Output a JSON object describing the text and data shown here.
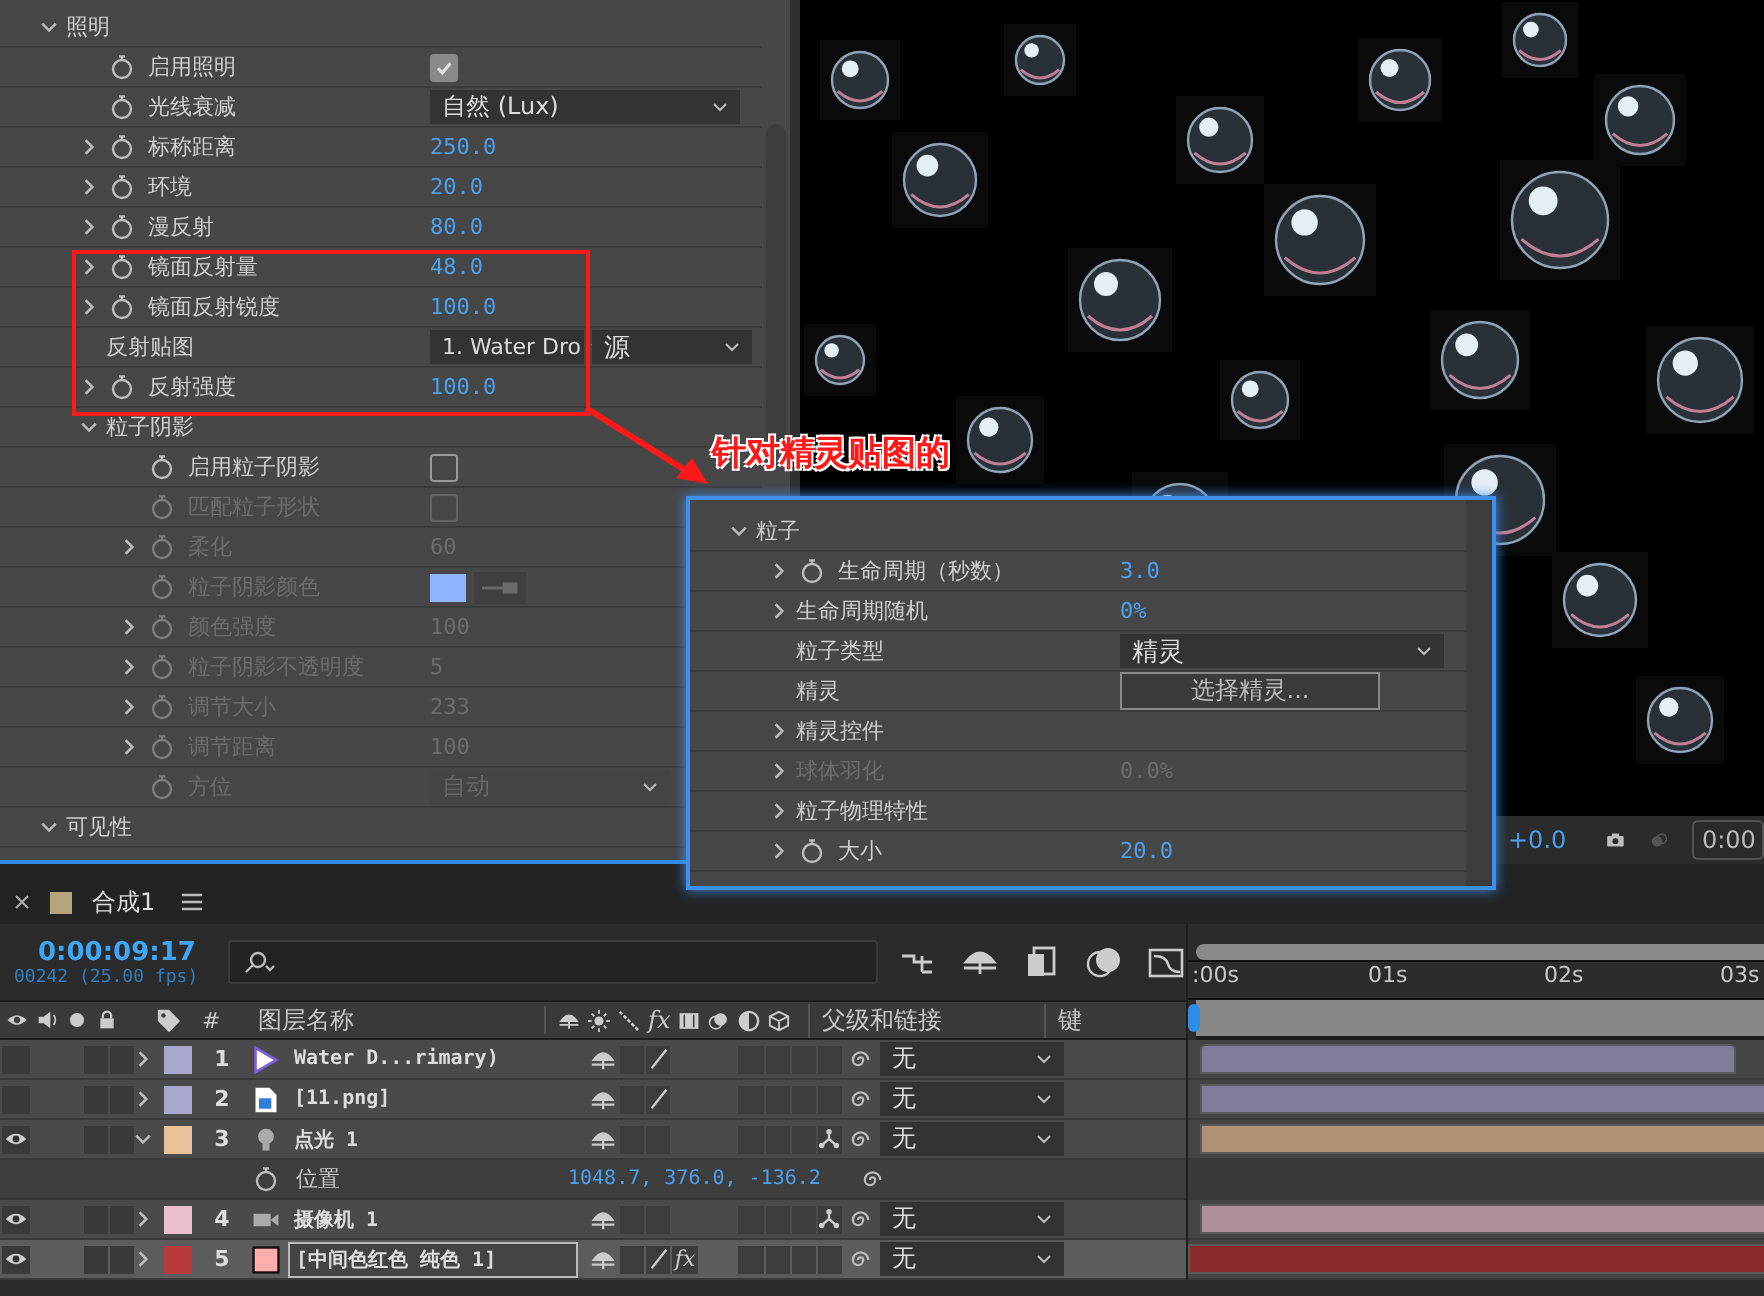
{
  "effects_panel": {
    "rows": [
      {
        "label": "照明",
        "kind": "group",
        "expanded": true,
        "children": [
          {
            "label": "启用照明",
            "kind": "checkbox",
            "stopwatch": true,
            "expandable": false,
            "checked": true,
            "disabled": false
          },
          {
            "label": "光线衰减",
            "kind": "dropdown",
            "stopwatch": true,
            "expandable": false,
            "value": "自然 (Lux)",
            "disabled": false
          },
          {
            "label": "标称距离",
            "kind": "number",
            "stopwatch": true,
            "expandable": true,
            "value": "250.0",
            "disabled": false
          },
          {
            "label": "环境",
            "kind": "number",
            "stopwatch": true,
            "expandable": true,
            "value": "20.0",
            "disabled": false
          },
          {
            "label": "漫反射",
            "kind": "number",
            "stopwatch": true,
            "expandable": true,
            "value": "80.0",
            "disabled": false
          },
          {
            "label": "镜面反射量",
            "kind": "number",
            "stopwatch": true,
            "expandable": true,
            "value": "48.0",
            "disabled": false
          },
          {
            "label": "镜面反射锐度",
            "kind": "number",
            "stopwatch": true,
            "expandable": true,
            "value": "100.0",
            "disabled": false
          },
          {
            "label": "反射贴图",
            "kind": "dropdown_pair",
            "stopwatch": false,
            "expandable": false,
            "value": "1. Water Dro",
            "value_2": "源",
            "disabled": false
          },
          {
            "label": "反射强度",
            "kind": "number",
            "stopwatch": true,
            "expandable": true,
            "value": "100.0",
            "disabled": false
          },
          {
            "label": "粒子阴影",
            "kind": "group",
            "expanded": true,
            "children": [
              {
                "label": "启用粒子阴影",
                "kind": "checkbox",
                "stopwatch": true,
                "expandable": false,
                "checked": false,
                "disabled": false
              },
              {
                "label": "匹配粒子形状",
                "kind": "checkbox",
                "stopwatch": true,
                "expandable": false,
                "checked": false,
                "disabled": true
              },
              {
                "label": "柔化",
                "kind": "number",
                "stopwatch": true,
                "expandable": true,
                "value": "60",
                "disabled": true
              },
              {
                "label": "粒子阴影颜色",
                "kind": "color",
                "stopwatch": true,
                "expandable": false,
                "color": "#8fb4ff",
                "disabled": true
              },
              {
                "label": "颜色强度",
                "kind": "number",
                "stopwatch": true,
                "expandable": true,
                "value": "100",
                "disabled": true
              },
              {
                "label": "粒子阴影不透明度",
                "kind": "number",
                "stopwatch": true,
                "expandable": true,
                "value": "5",
                "disabled": true
              },
              {
                "label": "调节大小",
                "kind": "number",
                "stopwatch": true,
                "expandable": true,
                "value": "233",
                "disabled": true
              },
              {
                "label": "调节距离",
                "kind": "number",
                "stopwatch": true,
                "expandable": true,
                "value": "100",
                "disabled": true
              },
              {
                "label": "方位",
                "kind": "dropdown",
                "stopwatch": true,
                "expandable": false,
                "value": "自动",
                "disabled": true
              }
            ]
          }
        ]
      },
      {
        "label": "可见性",
        "kind": "group",
        "expanded": true
      }
    ]
  },
  "viewer": {
    "exposure": "+0.0",
    "timecode": "0:00"
  },
  "annotation": {
    "text": "针对精灵贴图的"
  },
  "callout_panel": {
    "rows": [
      {
        "label": "粒子",
        "kind": "group",
        "expanded": true,
        "children": [
          {
            "label": "生命周期（秒数）",
            "kind": "number",
            "stopwatch": true,
            "expandable": true,
            "value": "3.0",
            "disabled": false
          },
          {
            "label": "生命周期随机",
            "kind": "number",
            "stopwatch": false,
            "expandable": true,
            "value": "0%",
            "disabled": false
          },
          {
            "label": "粒子类型",
            "kind": "dropdown",
            "stopwatch": false,
            "expandable": false,
            "value": "精灵",
            "disabled": false
          },
          {
            "label": "精灵",
            "kind": "button",
            "stopwatch": false,
            "expandable": false,
            "value": "选择精灵...",
            "disabled": false
          },
          {
            "label": "精灵控件",
            "kind": "none",
            "stopwatch": false,
            "expandable": true,
            "disabled": false
          },
          {
            "label": "球体羽化",
            "kind": "number",
            "stopwatch": false,
            "expandable": true,
            "value": "0.0%",
            "disabled": true
          },
          {
            "label": "粒子物理特性",
            "kind": "none",
            "stopwatch": false,
            "expandable": true,
            "disabled": false
          },
          {
            "label": "大小",
            "kind": "number",
            "stopwatch": true,
            "expandable": true,
            "value": "20.0",
            "disabled": false
          }
        ]
      }
    ]
  },
  "timeline": {
    "tab": {
      "title": "合成1"
    },
    "current_time": "0:00:09:17",
    "frame_info": "00242 (25.00 fps)",
    "columns": {
      "index": "#",
      "name": "图层名称",
      "effects": "fx",
      "parent": "父级和链接",
      "keys": "键"
    },
    "ruler": [
      ":00s",
      "01s",
      "02s",
      "03s"
    ],
    "layers": [
      {
        "index": "1",
        "name": "Water D...rimary)",
        "kind": "footage",
        "color": "#a9a9cf",
        "visible": false,
        "expanded": false,
        "selected": false,
        "quality": true,
        "three_d": false,
        "parent": "无",
        "bar_trimmed": true
      },
      {
        "index": "2",
        "name": "[11.png]",
        "kind": "image",
        "color": "#a9a9cf",
        "visible": false,
        "expanded": false,
        "selected": false,
        "quality": true,
        "three_d": false,
        "parent": "无",
        "bar_trimmed": false
      },
      {
        "index": "3",
        "name": "点光 1",
        "kind": "light",
        "color": "#e9c199",
        "visible": true,
        "expanded": true,
        "selected": false,
        "quality": false,
        "three_d": true,
        "parent": "无",
        "bar_trimmed": false,
        "properties": [
          {
            "label": "位置",
            "value": "1048.7, 376.0, -136.2"
          }
        ]
      },
      {
        "index": "4",
        "name": "摄像机 1",
        "kind": "camera",
        "color": "#e8bfcb",
        "visible": true,
        "expanded": false,
        "selected": false,
        "quality": false,
        "three_d": true,
        "parent": "无",
        "bar_trimmed": false
      },
      {
        "index": "5",
        "name": "[中间色红色 纯色 1]",
        "kind": "solid",
        "color": "#b83a3a",
        "visible": true,
        "expanded": false,
        "selected": true,
        "quality": true,
        "three_d": false,
        "effects": "fx",
        "parent": "无",
        "bar_trimmed": false
      }
    ]
  }
}
